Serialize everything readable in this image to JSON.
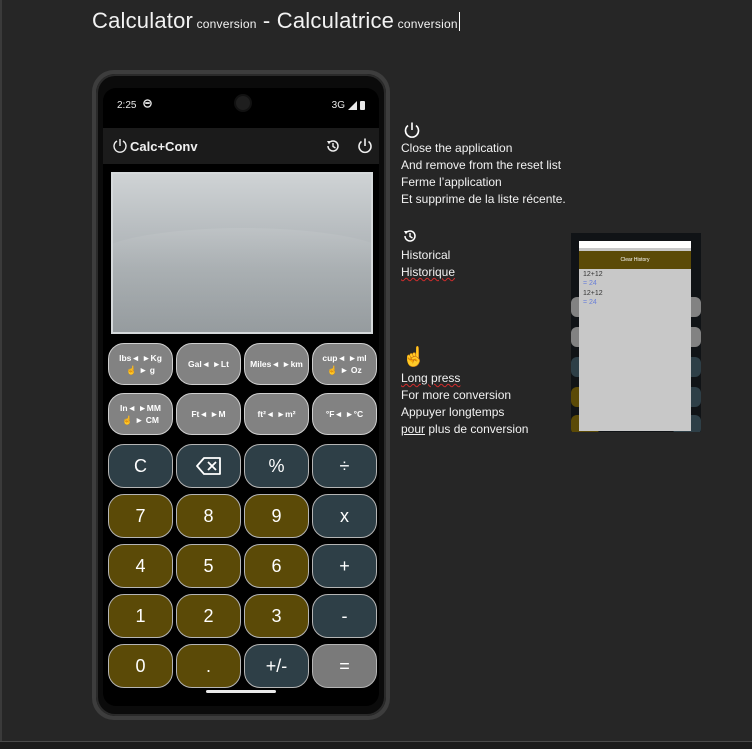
{
  "title": {
    "part1": "Calculator",
    "part1_small": " conversion",
    "separator": " - ",
    "part2": "Calculatrice",
    "part2_small": " conversion"
  },
  "phone": {
    "status": {
      "time": "2:25",
      "network": "3G"
    },
    "app_title": "Calc+Conv",
    "conversion_buttons": [
      {
        "line1": "lbs◄ ►Kg",
        "line2": "☝ ► g"
      },
      {
        "line1": "Gal◄ ►Lt",
        "line2": ""
      },
      {
        "line1": "Miles◄ ►km",
        "line2": ""
      },
      {
        "line1": "cup◄ ►ml",
        "line2": "☝ ► Oz"
      },
      {
        "line1": "In◄ ►MM",
        "line2": "☝ ► CM"
      },
      {
        "line1": "Ft◄ ►M",
        "line2": ""
      },
      {
        "line1": "ft²◄ ►m²",
        "line2": ""
      },
      {
        "line1": "°F◄ ►°C",
        "line2": ""
      }
    ],
    "keys": {
      "clear": "C",
      "backspace": "⌫",
      "percent": "%",
      "divide": "÷",
      "seven": "7",
      "eight": "8",
      "nine": "9",
      "multiply": "x",
      "four": "4",
      "five": "5",
      "six": "6",
      "plus": "+",
      "one": "1",
      "two": "2",
      "three": "3",
      "minus": "-",
      "zero": "0",
      "dot": ".",
      "sign": "+/-",
      "equals": "="
    }
  },
  "notes": {
    "close": [
      "Close the application",
      "And remove from the reset list",
      "Ferme l’application",
      "Et supprime de la liste récente."
    ],
    "history": [
      "Historical",
      "Historique"
    ],
    "longpress": {
      "line1": "Long press",
      "line2": "For more conversion",
      "line3": "Appuyer longtemps",
      "line4_underlined": "pour",
      "line4_rest": " plus de conversion"
    }
  },
  "thumbnail": {
    "header": "Clear History",
    "lines": [
      "12+12",
      "= 24",
      "12+12",
      "= 24"
    ]
  },
  "colors": {
    "digit_key": "#5b4a07",
    "operator_key": "#2e3f47",
    "conversion_key": "#828282",
    "equals_key": "#7a7a7a"
  },
  "icons": [
    "power-icon",
    "history-icon",
    "hand-point-up-icon",
    "backspace-icon",
    "app-logo-icon"
  ]
}
